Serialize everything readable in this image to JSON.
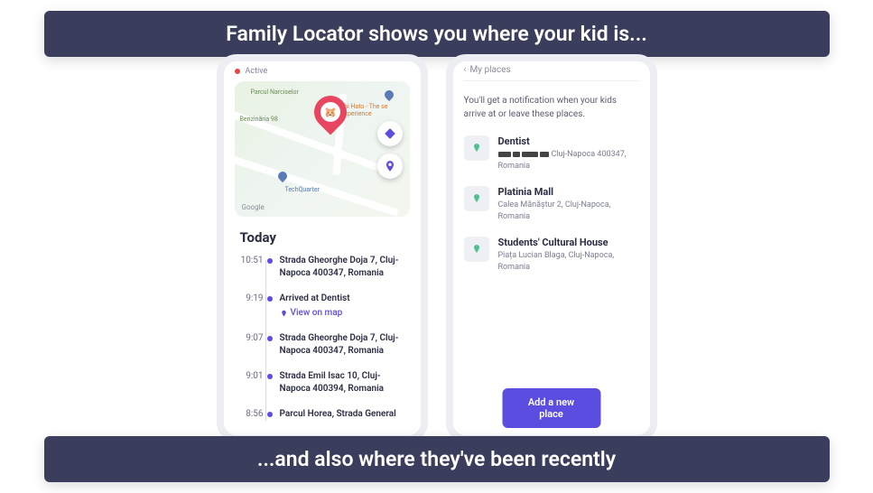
{
  "banners": {
    "top": "Family Locator shows you where your kid is...",
    "bottom": "...and also where they've been recently"
  },
  "phone_left": {
    "status": "Active",
    "map": {
      "labels": {
        "park": "Parcul\nNarciselor",
        "gas": "Benzinăria 98",
        "tech": "TechQuarter",
        "poi": "shi Hato - The\nse Experience"
      },
      "google": "Google"
    },
    "section_title": "Today",
    "timeline": [
      {
        "time": "10:51",
        "text": "Strada Gheorghe Doja 7, Cluj-Napoca 400347, Romania"
      },
      {
        "time": "9:19",
        "text": "Arrived at Dentist",
        "link": "View on map"
      },
      {
        "time": "9:07",
        "text": "Strada Gheorghe Doja 7, Cluj-Napoca 400347, Romania"
      },
      {
        "time": "9:01",
        "text": "Strada Emil Isac 10, Cluj-Napoca 400394, Romania"
      },
      {
        "time": "8:56",
        "text": "Parcul Horea, Strada General"
      }
    ]
  },
  "phone_right": {
    "header": "My places",
    "note": "You'll get a notification when your kids arrive at or leave these places.",
    "places": [
      {
        "title": "Dentist",
        "addr_suffix": " Cluj-Napoca 400347, Romania",
        "redacted": true
      },
      {
        "title": "Platinia Mall",
        "addr": "Calea Mănăștur 2, Cluj-Napoca, Romania"
      },
      {
        "title": "Students' Cultural House",
        "addr": "Piața Lucian Blaga, Cluj-Napoca, Romania"
      }
    ],
    "add_button": "Add a new place"
  }
}
